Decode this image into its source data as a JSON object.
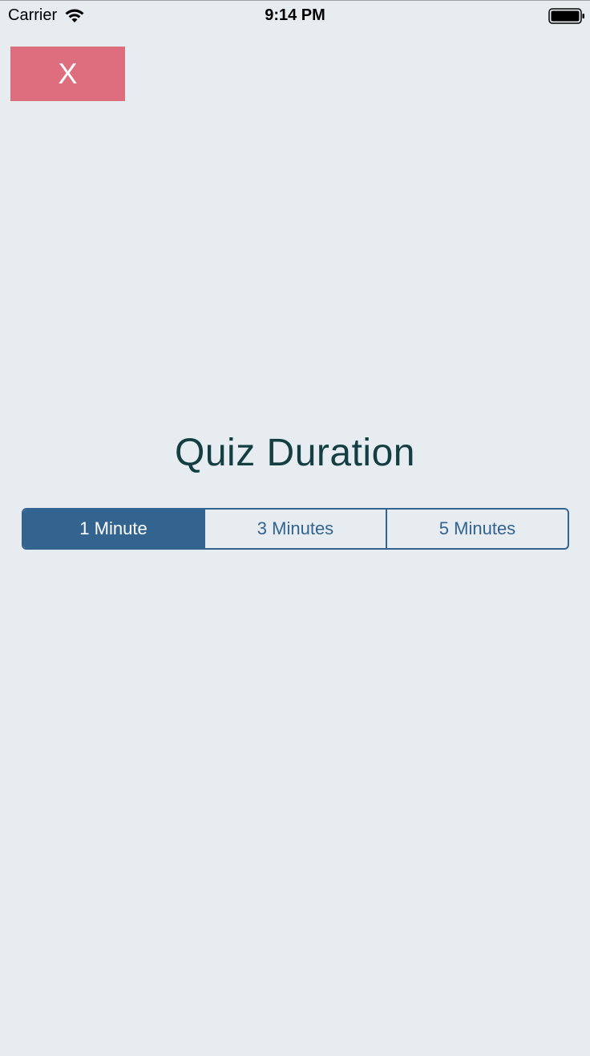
{
  "status_bar": {
    "carrier": "Carrier",
    "time": "9:14 PM",
    "icons": [
      "wifi-icon",
      "battery-icon"
    ]
  },
  "close_button": {
    "label": "X",
    "color": "#de6e7e"
  },
  "title": "Quiz Duration",
  "duration_selector": {
    "options": [
      "1 Minute",
      "3 Minutes",
      "5 Minutes"
    ],
    "selected": "1 Minute",
    "accent_color": "#33648f"
  },
  "colors": {
    "background": "#e7ecf1",
    "title": "#133f43"
  }
}
